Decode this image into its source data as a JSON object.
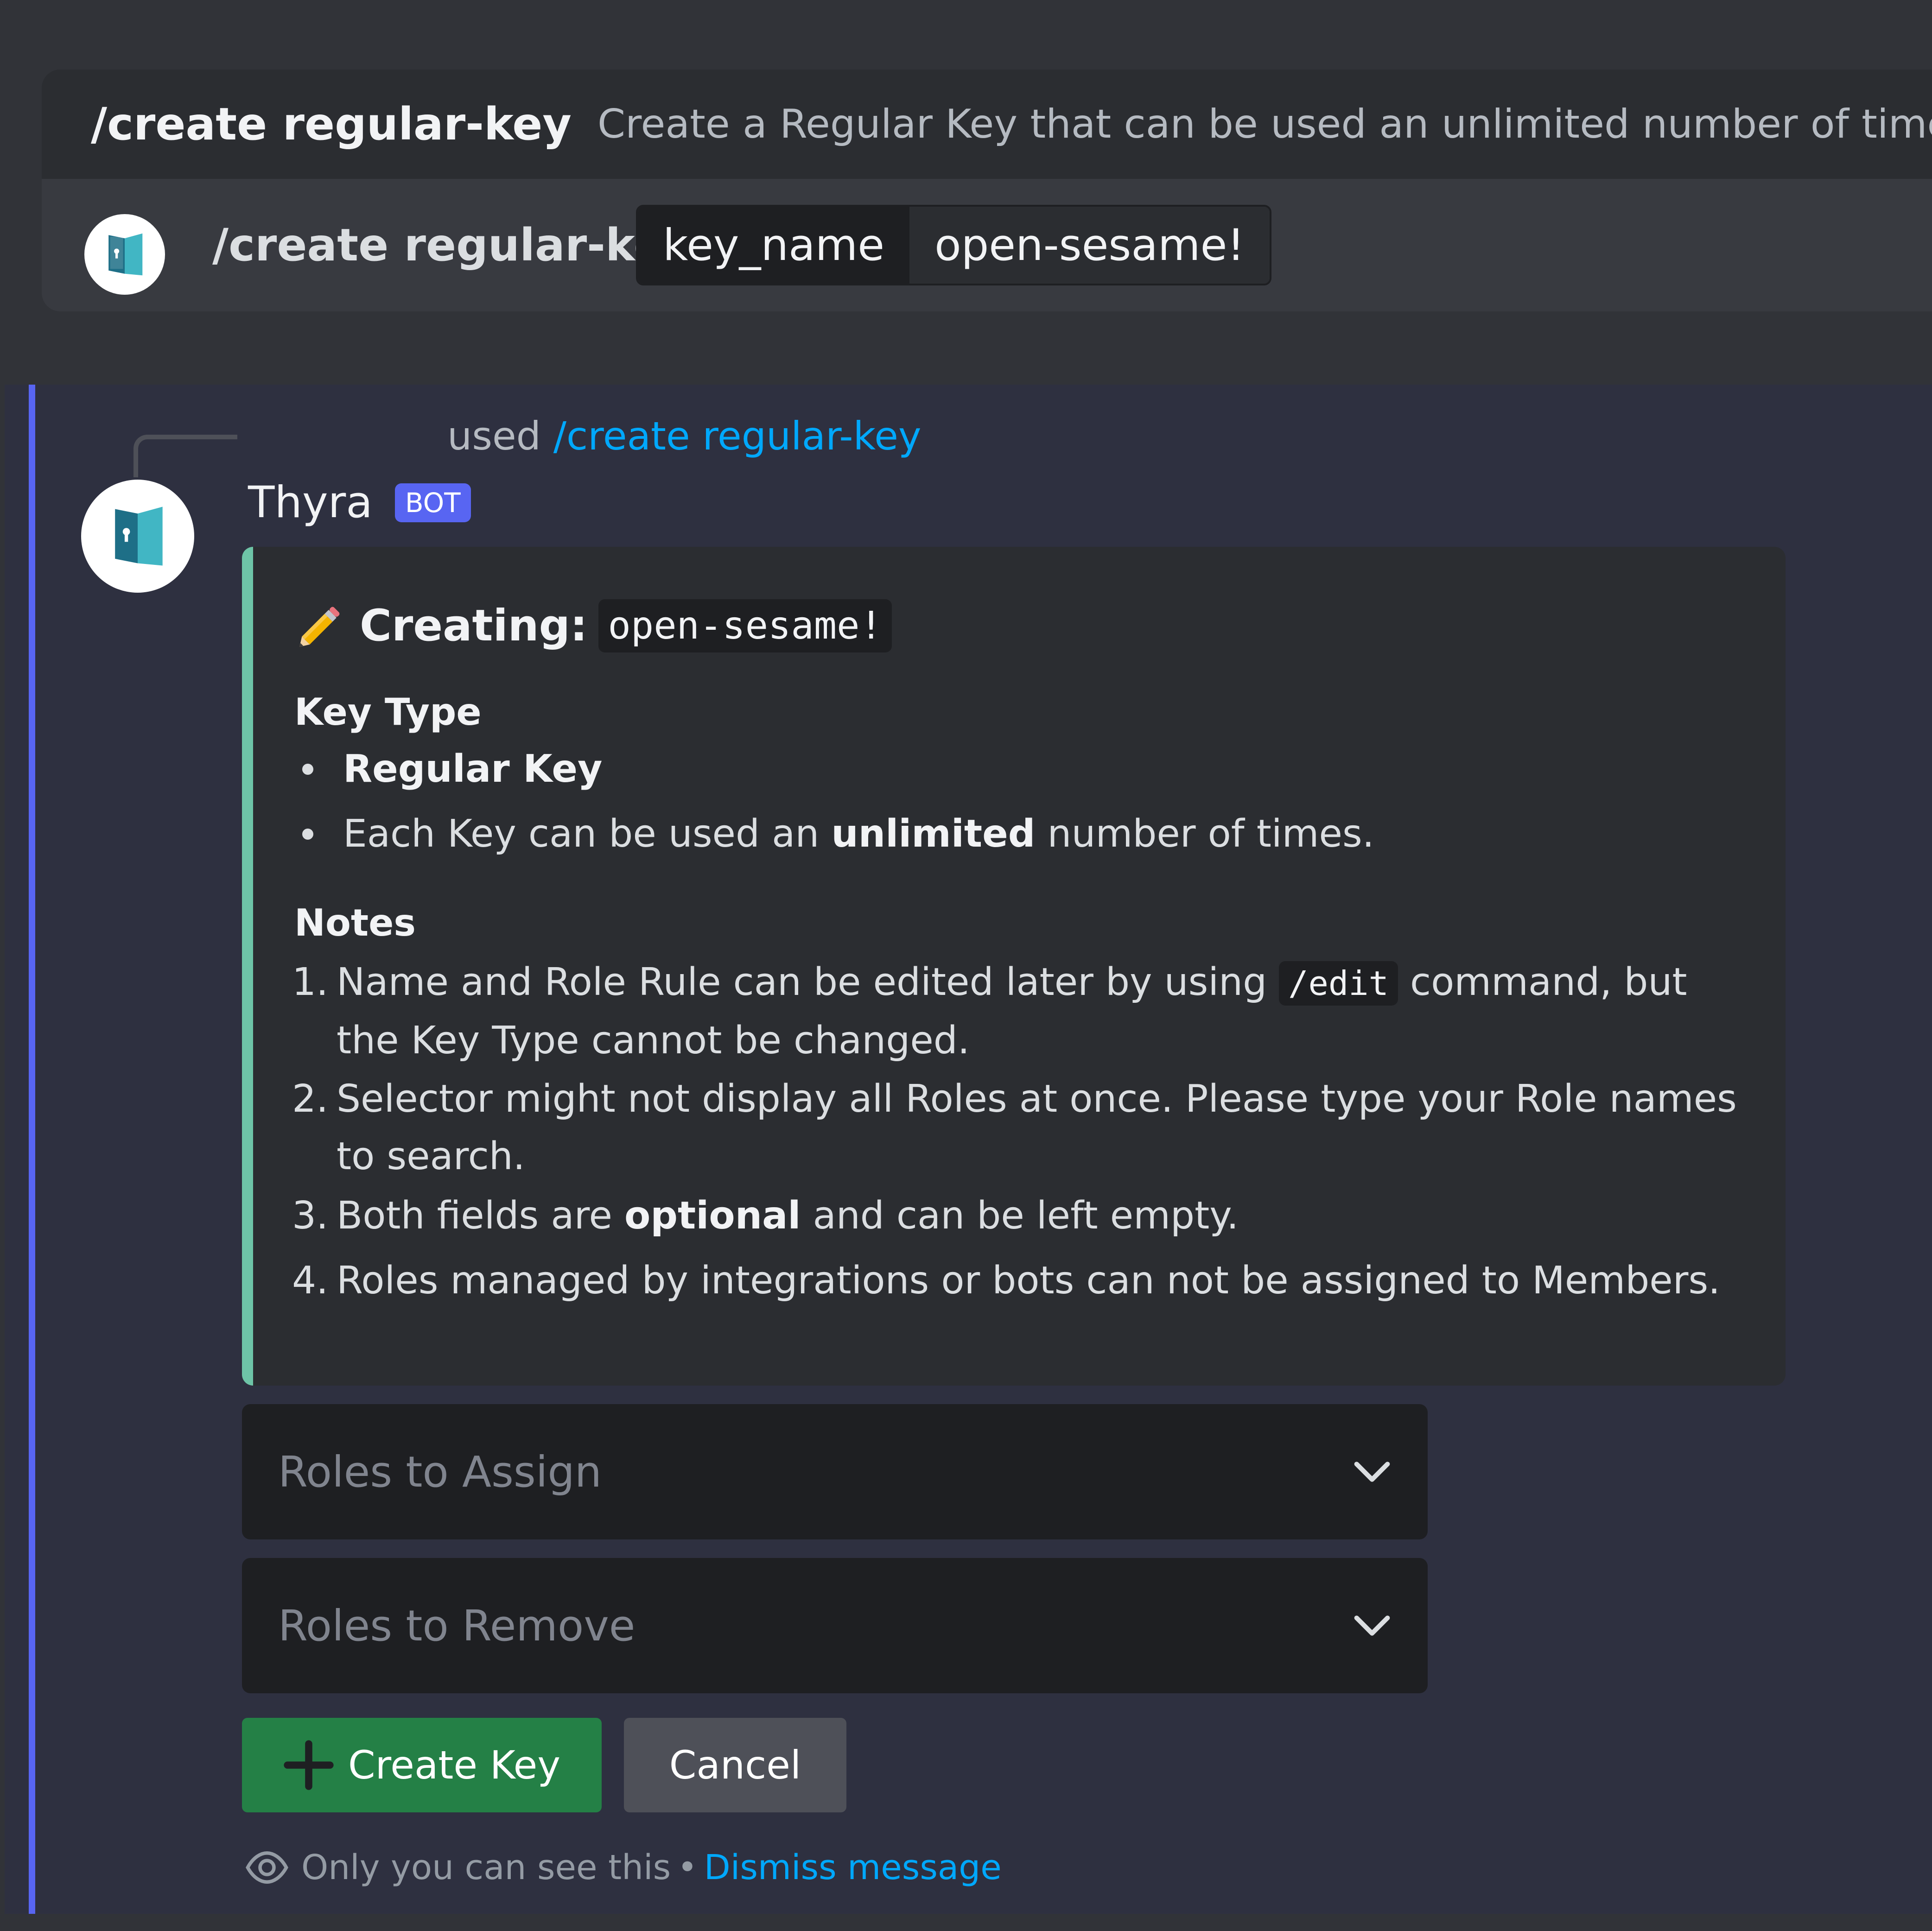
{
  "autocomplete": {
    "command": "/create regular-key",
    "description": "Create a Regular Key that can be used an unlimited number of times."
  },
  "composer": {
    "command": "/create regular-key",
    "option_name": "key_name",
    "option_value": "open-sesame!"
  },
  "message": {
    "reply_prefix": "used",
    "reply_command": "/create regular-key",
    "author": "Thyra",
    "badge": "BOT",
    "embed": {
      "title_label": "Creating:",
      "title_code": "open-sesame!",
      "key_type_heading": "Key Type",
      "key_type_name": "Regular Key",
      "key_type_desc_pre": "Each Key can be used an ",
      "key_type_desc_bold": "unlimited",
      "key_type_desc_post": " number of times.",
      "notes_heading": "Notes",
      "notes": [
        {
          "num": "1.",
          "pre": "Name and Role Rule can be edited later by using ",
          "code": "/edit",
          "post": " command, but the Key Type cannot be changed."
        },
        {
          "num": "2.",
          "text": "Selector might not display all Roles at once. Please type your Role names to search."
        },
        {
          "num": "3.",
          "pre": "Both fields are ",
          "bold": "optional",
          "post": " and can be left empty."
        },
        {
          "num": "4.",
          "text": "Roles managed by integrations or bots can not be assigned to Members."
        }
      ]
    },
    "selects": [
      {
        "placeholder": "Roles to Assign"
      },
      {
        "placeholder": "Roles to Remove"
      }
    ],
    "buttons": {
      "create": "Create Key",
      "cancel": "Cancel"
    },
    "ephemeral": {
      "note": "Only you can see this",
      "separator": "•",
      "dismiss": "Dismiss message"
    }
  },
  "colors": {
    "accent_green": "#6ec4a7",
    "blurple": "#5865f2",
    "link": "#00a8fc",
    "success": "#248046"
  }
}
